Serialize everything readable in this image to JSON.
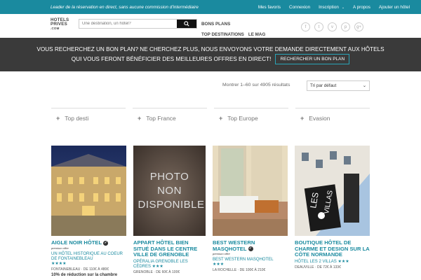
{
  "topbar": {
    "tagline": "Leader de la réservation en direct, sans aucune commission d'intermédiaire",
    "links": [
      "Mes favoris",
      "Connexion",
      "Inscription",
      "A propos",
      "Ajouter un hôtel"
    ]
  },
  "logo": {
    "line1": "HOTELS",
    "line2": "PRIVES",
    "line3": ".COM"
  },
  "search": {
    "placeholder": "Une destination, un hôtel?"
  },
  "nav": {
    "bons_plans": "BONS PLANS",
    "top_destinations": "TOP DESTINATIONS",
    "le_mag": "LE MAG"
  },
  "socials": [
    "f",
    "t",
    "v",
    "p",
    "g+"
  ],
  "banner": {
    "line1": "VOUS RECHERCHEZ UN BON PLAN? NE CHERCHEZ PLUS, NOUS ENVOYONS VOTRE DEMANDE DIRECTEMENT AUX HÔTELS",
    "line2": "QUI VOUS FERONT BÉNÉFICIER DES MEILLEURES OFFRES EN DIRECT!",
    "cta": "RECHERCHER UN BON PLAN"
  },
  "results": {
    "count_text": "Montrer 1–60 sur 4905 résultats",
    "sort": "Tri par défaut"
  },
  "categories": [
    "Top desti",
    "Top France",
    "Top Europe",
    "Evasion"
  ],
  "cards": [
    {
      "title": "AIGLE NOIR HÔTEL",
      "tag": "premium offre",
      "sub": "UN HÔTEL HISTORIQUE AU COEUR DE FONTAINEBLEAU",
      "stars": "★★★★",
      "loc": "FONTAINEBLEAU · DE 110€ À 480€",
      "promo": "10% de réduction sur la chambre"
    },
    {
      "title": "APPART HÔTEL BIEN SITUÉ DANS LE CENTRE VILLE DE GRENOBLE",
      "sub": "OPÉRALIA GRENOBLE LES CÈDRES ★★★",
      "loc": "GRENOBLE · DE 60€ À 100€",
      "placeholder_text": "PHOTO NON DISPONIBLE"
    },
    {
      "title": "BEST WESTERN MASQHOTEL",
      "tag": "premium offre",
      "sub": "BEST WESTERN MASQHOTEL",
      "stars": "★★★",
      "loc": "LA ROCHELLE · DE 100€ À 210€"
    },
    {
      "title": "BOUTIQUE HÔTEL DE CHARME ET DESIGN SUR LA CÔTE NORMANDE",
      "sub": "HÔTEL LES 2 VILLAS ★★★",
      "loc": "DEAUVILLE · DE 72€ À 133€"
    }
  ],
  "colors": {
    "accent": "#1a8a9f",
    "banner_bg": "#3a3a3a"
  }
}
